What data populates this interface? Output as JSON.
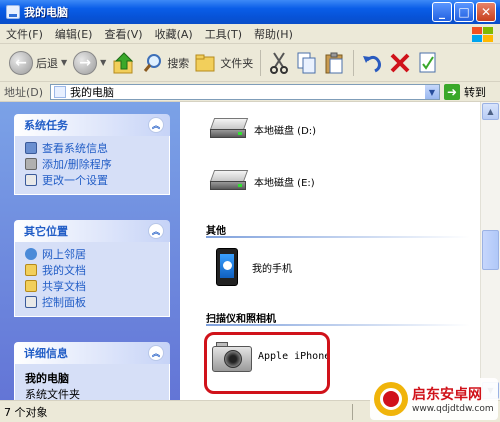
{
  "window": {
    "title": "我的电脑",
    "buttons": [
      "_",
      "□",
      "✕"
    ]
  },
  "menu": [
    "文件(F)",
    "编辑(E)",
    "查看(V)",
    "收藏(A)",
    "工具(T)",
    "帮助(H)"
  ],
  "toolbar": {
    "back": "后退",
    "search": "搜索",
    "folders": "文件夹"
  },
  "address": {
    "label": "地址(D)",
    "value": "我的电脑",
    "go": "转到"
  },
  "sidebar": {
    "system_tasks": {
      "title": "系统任务",
      "items": [
        "查看系统信息",
        "添加/删除程序",
        "更改一个设置"
      ]
    },
    "other_places": {
      "title": "其它位置",
      "items": [
        "网上邻居",
        "我的文档",
        "共享文档",
        "控制面板"
      ]
    },
    "details": {
      "title": "详细信息",
      "name": "我的电脑",
      "type": "系统文件夹"
    }
  },
  "content": {
    "drives": [
      "本地磁盘 (D:)",
      "本地磁盘 (E:)"
    ],
    "other_group": "其他",
    "other_items": [
      "我的手机"
    ],
    "scanner_group": "扫描仪和照相机",
    "scanner_items": [
      "Apple iPhone"
    ]
  },
  "status": {
    "objects": "7 个对象"
  },
  "watermark": {
    "title": "启东安卓网",
    "url": "www.qdjdtdw.com"
  },
  "colors": {
    "highlight": "#d0121a",
    "titlebar": "#0753d8",
    "sidepanel": "#7ba2e7"
  }
}
